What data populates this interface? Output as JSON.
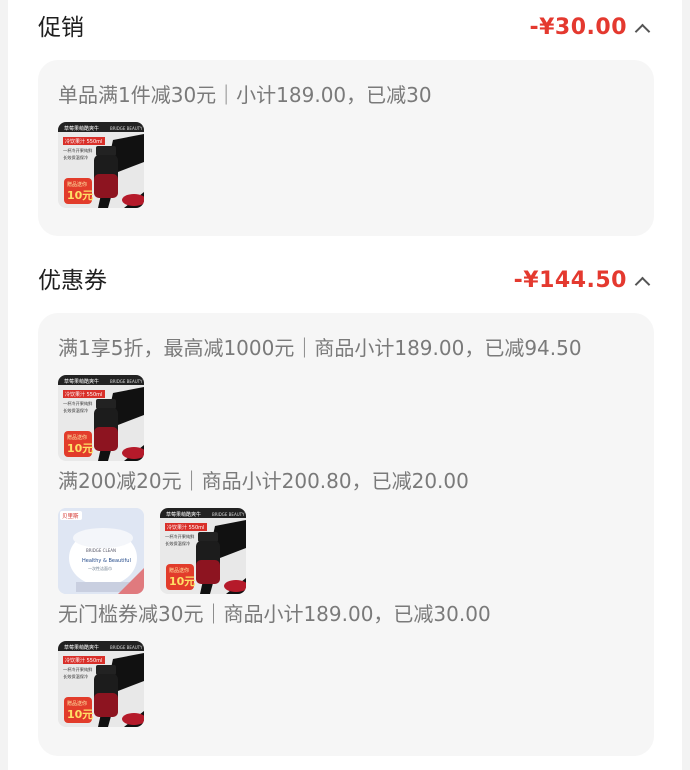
{
  "promotion": {
    "title": "促销",
    "amount": "-¥30.00",
    "rule_line": "单品满1件减30元｜小计189.00，已减30"
  },
  "coupon": {
    "title": "优惠券",
    "amount": "-¥144.50",
    "lines": [
      "满1享5折，最高减1000元｜商品小计189.00，已减94.50",
      "满200减20元｜商品小计200.80，已减20.00",
      "无门槛券减30元｜商品小计189.00，已减30.00"
    ]
  },
  "product_thumb": {
    "header_text": "草莓果萌酷爽牛",
    "brand_text": "BRIDGE BEAUTY",
    "tag_red": "冷饮果汁 550ml",
    "bullet1": "一杯冷开果纯鲜",
    "bullet2": "长效保温保冷",
    "badge_top": "赠品送你",
    "badge_value": "10元"
  },
  "towel_thumb": {
    "brand_badge": "贝里斯",
    "logo_text": "BRIDGE CLEAN",
    "pack_text": "Healthy & Beautiful",
    "sub_text": "一次性洁面巾"
  },
  "colors": {
    "accent": "#e4392f",
    "card_bg": "#f6f6f6",
    "muted_text": "#7a7a7a"
  }
}
